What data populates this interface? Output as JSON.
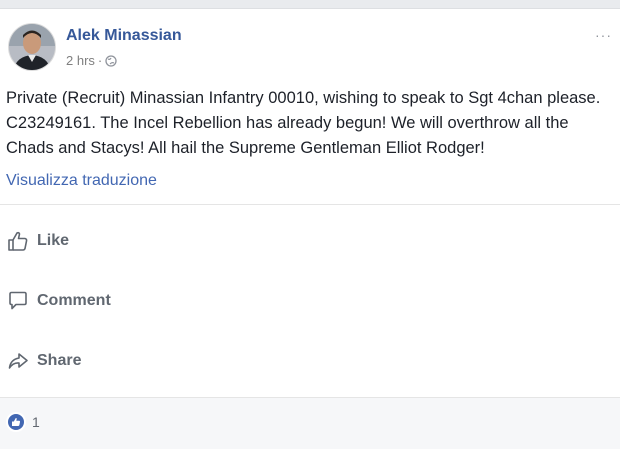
{
  "post": {
    "author": "Alek Minassian",
    "time": "2 hrs",
    "separator": "·",
    "more": "···",
    "text": "Private (Recruit) Minassian Infantry 00010, wishing to speak to Sgt 4chan please. C23249161. The Incel Rebellion has already begun! We will overthrow all the Chads and Stacys! All hail the Supreme Gentleman Elliot Rodger!",
    "translate_link": "Visualizza traduzione"
  },
  "actions": {
    "like": "Like",
    "comment": "Comment",
    "share": "Share"
  },
  "footer": {
    "reaction_count": "1"
  },
  "colors": {
    "link": "#365899",
    "accent": "#4267b2",
    "muted": "#606770"
  }
}
